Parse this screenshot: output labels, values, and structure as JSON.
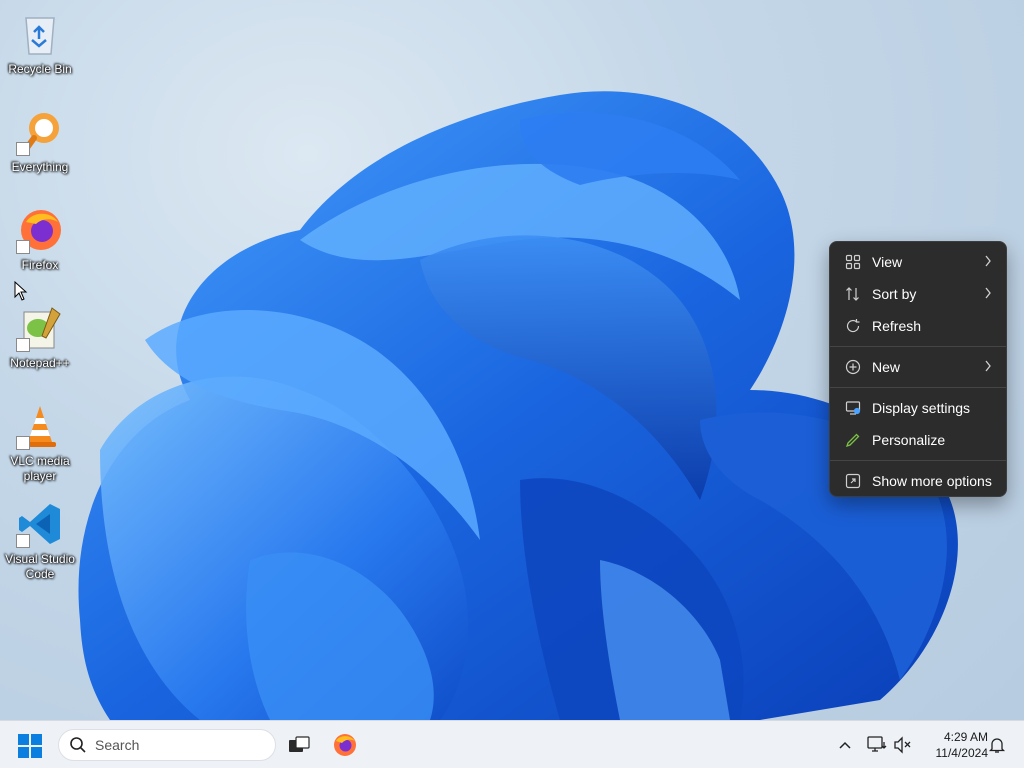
{
  "desktop": {
    "icons": [
      {
        "label": "Recycle Bin",
        "icon": "recycle-bin-icon"
      },
      {
        "label": "Everything",
        "icon": "everything-search-icon"
      },
      {
        "label": "Firefox",
        "icon": "firefox-icon"
      },
      {
        "label": "Notepad++",
        "icon": "notepad-plus-plus-icon"
      },
      {
        "label": "VLC media player",
        "icon": "vlc-cone-icon"
      },
      {
        "label": "Visual Studio Code",
        "icon": "vscode-icon"
      }
    ]
  },
  "context_menu": {
    "items": [
      {
        "label": "View",
        "icon": "view-grid-icon",
        "submenu": true
      },
      {
        "label": "Sort by",
        "icon": "sort-icon",
        "submenu": true
      },
      {
        "label": "Refresh",
        "icon": "refresh-icon",
        "submenu": false
      },
      {
        "label": "New",
        "icon": "new-plus-icon",
        "submenu": true
      },
      {
        "label": "Display settings",
        "icon": "display-settings-icon",
        "submenu": false
      },
      {
        "label": "Personalize",
        "icon": "personalize-pen-icon",
        "submenu": false
      },
      {
        "label": "Show more options",
        "icon": "show-more-options-icon",
        "submenu": false
      }
    ]
  },
  "taskbar": {
    "search_placeholder": "Search",
    "clock_time": "4:29 AM",
    "clock_date": "11/4/2024"
  },
  "colors": {
    "menu_bg": "#2c2c2c",
    "accent": "#0078d4",
    "bloom": "#1f6fe8"
  }
}
